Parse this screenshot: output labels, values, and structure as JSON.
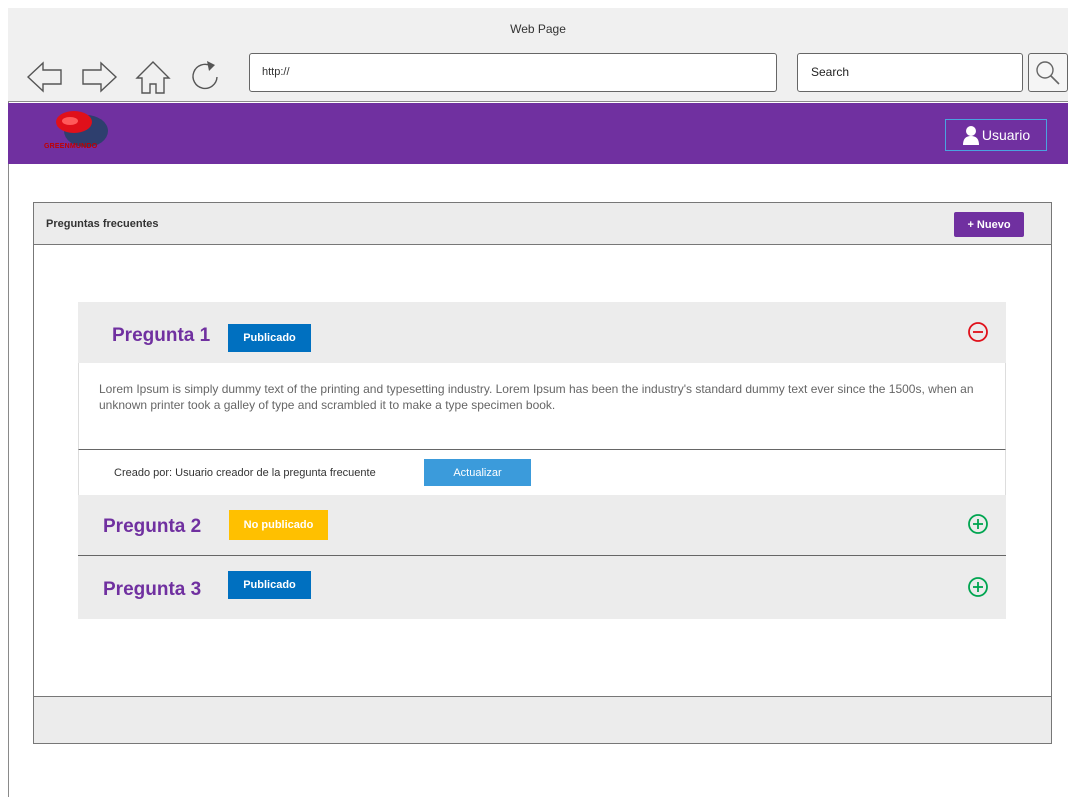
{
  "browser": {
    "window_title": "Web Page",
    "url": "http://",
    "search_placeholder": "Search"
  },
  "header": {
    "logo_text": "GREENMUNDO",
    "user_label": "Usuario",
    "brand_color": "#7030a0"
  },
  "panel": {
    "title": "Preguntas frecuentes",
    "new_button": "+ Nuevo"
  },
  "faqs": [
    {
      "title": "Pregunta 1",
      "status": "Publicado",
      "status_color": "#0070c0",
      "expanded": true,
      "toggle_icon": "minus-circle-icon",
      "answer": "Lorem Ipsum is simply dummy text of the printing and typesetting industry. Lorem Ipsum has been the industry's standard dummy text ever since the 1500s, when an unknown printer took a galley of type and scrambled it to make a type specimen book.",
      "created_by": "Creado por: Usuario creador de la pregunta frecuente",
      "update_button": "Actualizar"
    },
    {
      "title": "Pregunta 2",
      "status": "No publicado",
      "status_color": "#ffc000",
      "expanded": false,
      "toggle_icon": "plus-circle-icon"
    },
    {
      "title": "Pregunta 3",
      "status": "Publicado",
      "status_color": "#0070c0",
      "expanded": false,
      "toggle_icon": "plus-circle-icon"
    }
  ]
}
